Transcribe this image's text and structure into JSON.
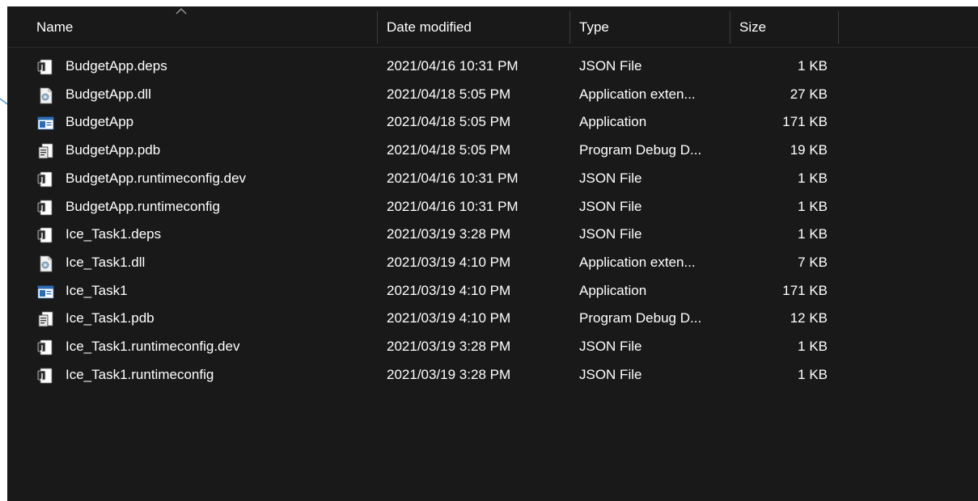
{
  "columns": {
    "name": "Name",
    "date": "Date modified",
    "type": "Type",
    "size": "Size"
  },
  "files": [
    {
      "name": "BudgetApp.deps",
      "date": "2021/04/16 10:31 PM",
      "type": "JSON File",
      "size": "1 KB",
      "icon": "json-file-icon"
    },
    {
      "name": "BudgetApp.dll",
      "date": "2021/04/18 5:05 PM",
      "type": "Application exten...",
      "size": "27 KB",
      "icon": "dll-file-icon"
    },
    {
      "name": "BudgetApp",
      "date": "2021/04/18 5:05 PM",
      "type": "Application",
      "size": "171 KB",
      "icon": "application-icon"
    },
    {
      "name": "BudgetApp.pdb",
      "date": "2021/04/18 5:05 PM",
      "type": "Program Debug D...",
      "size": "19 KB",
      "icon": "pdb-file-icon"
    },
    {
      "name": "BudgetApp.runtimeconfig.dev",
      "date": "2021/04/16 10:31 PM",
      "type": "JSON File",
      "size": "1 KB",
      "icon": "json-file-icon"
    },
    {
      "name": "BudgetApp.runtimeconfig",
      "date": "2021/04/16 10:31 PM",
      "type": "JSON File",
      "size": "1 KB",
      "icon": "json-file-icon"
    },
    {
      "name": "Ice_Task1.deps",
      "date": "2021/03/19 3:28 PM",
      "type": "JSON File",
      "size": "1 KB",
      "icon": "json-file-icon"
    },
    {
      "name": "Ice_Task1.dll",
      "date": "2021/03/19 4:10 PM",
      "type": "Application exten...",
      "size": "7 KB",
      "icon": "dll-file-icon"
    },
    {
      "name": "Ice_Task1",
      "date": "2021/03/19 4:10 PM",
      "type": "Application",
      "size": "171 KB",
      "icon": "application-icon"
    },
    {
      "name": "Ice_Task1.pdb",
      "date": "2021/03/19 4:10 PM",
      "type": "Program Debug D...",
      "size": "12 KB",
      "icon": "pdb-file-icon"
    },
    {
      "name": "Ice_Task1.runtimeconfig.dev",
      "date": "2021/03/19 3:28 PM",
      "type": "JSON File",
      "size": "1 KB",
      "icon": "json-file-icon"
    },
    {
      "name": "Ice_Task1.runtimeconfig",
      "date": "2021/03/19 3:28 PM",
      "type": "JSON File",
      "size": "1 KB",
      "icon": "json-file-icon"
    }
  ],
  "colors": {
    "background": "#191919",
    "text": "#ffffff",
    "arrow": "#5b9bd5"
  }
}
